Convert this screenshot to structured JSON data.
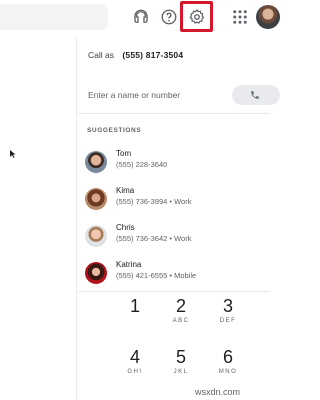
{
  "header": {
    "icons": [
      "headset-icon",
      "help-icon",
      "gear-icon",
      "apps-icon",
      "avatar"
    ],
    "highlight_color": "#d6182f"
  },
  "dialer": {
    "call_as_label": "Call as",
    "call_as_number": "(555) 817-3504",
    "input_placeholder": "Enter a name or number",
    "suggestions_title": "SUGGESTIONS",
    "contacts": [
      {
        "name": "Tom",
        "detail": "(555) 228-3640"
      },
      {
        "name": "Kima",
        "detail": "(555) 736-3994 • Work"
      },
      {
        "name": "Chris",
        "detail": "(555) 736-3642 • Work"
      },
      {
        "name": "Katrina",
        "detail": "(555) 421-6555 • Mobile"
      }
    ],
    "keypad": [
      {
        "digit": "1",
        "letters": ""
      },
      {
        "digit": "2",
        "letters": "ABC"
      },
      {
        "digit": "3",
        "letters": "DEF"
      },
      {
        "digit": "4",
        "letters": "GHI"
      },
      {
        "digit": "5",
        "letters": "JKL"
      },
      {
        "digit": "6",
        "letters": "MNO"
      }
    ]
  },
  "watermark": "wsxdn.com"
}
